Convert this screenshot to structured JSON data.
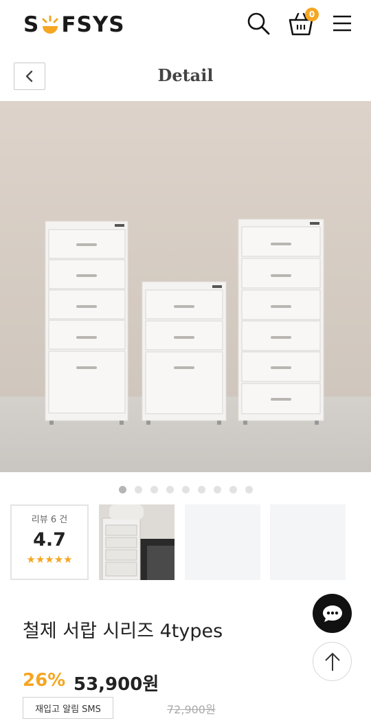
{
  "header": {
    "logo_left": "S",
    "logo_right": "FSYS",
    "cart_count": "0",
    "brand_color": "#f5a623"
  },
  "subheader": {
    "title": "Detail"
  },
  "carousel": {
    "total_slides": 9,
    "active_index": 0
  },
  "review": {
    "label": "리뷰 6 건",
    "score": "4.7",
    "stars": "★★★★★",
    "rating": 4.7
  },
  "product": {
    "name": "철제 서랍 시리즈 4types",
    "discount": "26%",
    "price": "53,900원",
    "original_price": "72,900원",
    "restock_label": "재입고 알림 SMS"
  },
  "icons": {
    "search": "search-icon",
    "cart": "cart-icon",
    "menu": "menu-icon",
    "back": "chevron-left-icon",
    "chat": "chat-icon",
    "top": "arrow-up-icon"
  }
}
